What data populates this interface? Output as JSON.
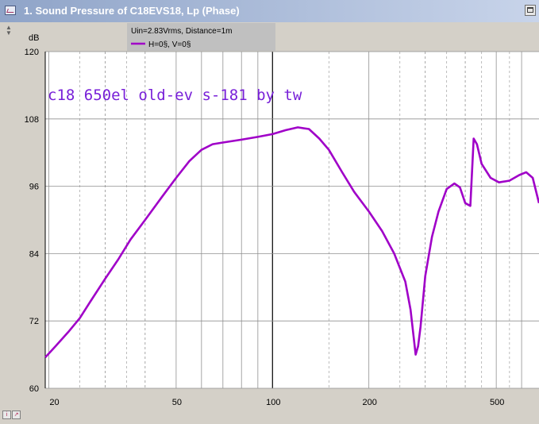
{
  "window": {
    "title": "1. Sound Pressure of C18EVS18, Lp (Phase)"
  },
  "icons": {
    "app": "chart-window-icon",
    "maximize": "maximize-icon",
    "scroll": "scroll-arrows-icon",
    "bottom_left": [
      "info-icon",
      "marker-icon"
    ]
  },
  "chart_data": {
    "type": "line",
    "annotation": "c18 650el old-ev s-181 by tw",
    "legend": {
      "header": "Uin=2.83Vrms, Distance=1m",
      "placement": "top-left",
      "entries": [
        {
          "label": "H=0§, V=0§",
          "color": "#a000c8"
        }
      ]
    },
    "ylabel": "dB",
    "ylim": [
      60,
      120
    ],
    "yticks": [
      60,
      72,
      84,
      96,
      108,
      120
    ],
    "xscale": "log",
    "xlim": [
      19.5,
      680
    ],
    "xticks": [
      20,
      50,
      100,
      200,
      500
    ],
    "grid": true,
    "series": [
      {
        "color": "#a000c8",
        "x": [
          19.5,
          21,
          23,
          25,
          27,
          30,
          33,
          36,
          40,
          45,
          50,
          55,
          60,
          65,
          70,
          80,
          90,
          100,
          110,
          120,
          130,
          140,
          150,
          165,
          180,
          200,
          220,
          240,
          260,
          270,
          280,
          285,
          290,
          300,
          315,
          330,
          350,
          370,
          385,
          400,
          415,
          425,
          435,
          450,
          480,
          510,
          550,
          590,
          620,
          650,
          680
        ],
        "values": [
          65.5,
          67.5,
          70,
          72.5,
          75.5,
          79.5,
          83,
          86.5,
          90,
          94,
          97.5,
          100.5,
          102.5,
          103.5,
          103.8,
          104.3,
          104.8,
          105.3,
          106,
          106.5,
          106.2,
          104.5,
          102.5,
          98.5,
          95,
          91.5,
          88,
          84,
          79,
          74,
          66,
          67.5,
          71,
          80,
          87,
          91.5,
          95.5,
          96.5,
          95.8,
          93,
          92.5,
          104.5,
          103.5,
          100,
          97.5,
          96.7,
          97,
          98,
          98.5,
          97.5,
          93
        ]
      }
    ]
  }
}
